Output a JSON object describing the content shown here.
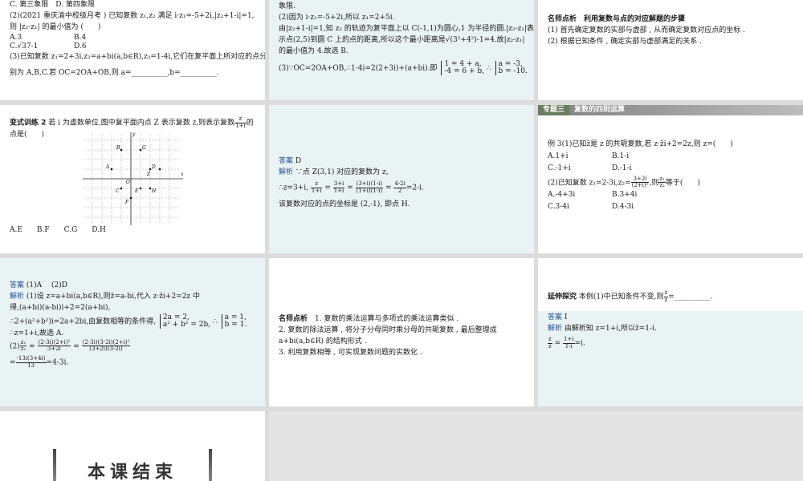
{
  "slide1": {
    "l1": "C. 第三象限　D. 第四象限",
    "l2": "(2)(2021 重庆渝中校级月考 ) 已知复数 z₁,z₂ 满足 i·z₁=-5+2i,|z₂+1-i|=1,",
    "l3": "则 |z₂-z₁| 的最小值为 (　　)",
    "opt_a": "A.3",
    "opt_b": "B.4",
    "opt_c": "C.√37-1",
    "opt_d": "D.6",
    "l4": "(3)已知复数 z₁=2+3i,z₂=a+bi(a,b∈R),z₃=1-4i,它们在复平面上所对应的点分",
    "l5": "别为 A,B,C.若 OC=2OA+OB,则 a=__________,b=__________."
  },
  "slide2": {
    "l1": "象限.",
    "l2": "(2)因为 i·z₁=-5+2i,所以 z₁=2+5i.",
    "l3": "由|z₂+1-i|=1,知 z₂ 的轨迹为复平面上以 C(-1,1)为圆心,1 为半径的圆.|z₂-z₁|表",
    "l4": "示点(2,5)到圆 C 上的点的距离,所以这个最小距离是√(3²+4²)-1=4.故|z₂-z₁|",
    "l5": "的最小值为 4.故选 B.",
    "l6": "(3)∵OC=2OA+OB,∴1-4i=2(2+3i)+(a+bi).即",
    "sys1": "1 = 4 + a,",
    "sys2": "-4 = 6 + b,",
    "therefore": "∴",
    "res1": "a = -3,",
    "res2": "b = -10."
  },
  "slide3": {
    "title": "名师点析　利用复数与点的对应解题的步骤",
    "l1": "(1) 首先确定复数的实部与虚部 , 从而确定复数对应点的坐标 .",
    "l2": "(2) 根据已知条件 , 确定实部与虚部满足的关系 ."
  },
  "slide4": {
    "title": "变式训练 2",
    "l1": " 若 i 为虚数单位,图中复平面内点 Z 表示复数 z,则表示复数",
    "frac_n": "z",
    "frac_d": "1+i",
    "l1_end": "的",
    "l2": "点是(　　)",
    "options": "A.E　　B.F　　C.G　　D.H",
    "axis_x": "x",
    "axis_y": "y",
    "origin": "O",
    "points": [
      "G",
      "B",
      "A",
      "D",
      "Z",
      "C",
      "E",
      "F",
      "H"
    ]
  },
  "slide5": {
    "answer_label": "答案",
    "answer": "D",
    "analysis_label": "解析",
    "l1": " ∵点 Z(3,1) 对应的复数为 z,",
    "l2_pre": "∴z=3+i,",
    "f1n": "z",
    "f1d": "1+i",
    "f2n": "3+i",
    "f2d": "1+i",
    "f3n": "(3+i)(1-i)",
    "f3d": "(1+i)(1-i)",
    "f4n": "4-2i",
    "f4d": "2",
    "l2_end": "=2-i.",
    "l3": "该复数对应的点的坐标是 (2,-1), 即点 H."
  },
  "slide6": {
    "tag": "专题三",
    "title": "复数的四则运算",
    "l1": "例 3(1)已知z̄是 z 的共轭复数,若 z·z̄i+2=2z,则 z=(　　)",
    "o1a": "A.1+i",
    "o1b": "B.1-i",
    "o1c": "C.-1+i",
    "o1d": "D.-1-i",
    "l2_pre": "(2)已知复数 z₁=2-3i,z₂=",
    "f1n": "3+2i",
    "f1d": "(2+i)²",
    "l2_mid": ",则",
    "f2n": "z₁",
    "f2d": "z₂",
    "l2_end": "等于(　　)",
    "o2a": "A.-4+3i",
    "o2b": "B.3+4i",
    "o2c": "C.3-4i",
    "o2d": "D.4-3i"
  },
  "slide7": {
    "answer_label": "答案",
    "answer": " (1)A　 (2)D",
    "analysis_label": "解析",
    "l1": " (1)设 z=a+bi(a,b∈R),则z̄=a-bi,代入 z·z̄i+2=2z 中",
    "l2": "得,(a+bi)(a-bi)i+2=2(a+bi),",
    "l3": "∴2+(a²+b²)i=2a+2bi,由复数相等的条件得,",
    "s1": "2a = 2,",
    "s2": "a² + b² = 2b,",
    "th": "∴",
    "r1": "a = 1,",
    "r2": "b = 1.",
    "l4": "∴z=1+i,故选 A.",
    "l5_pre": "(2)",
    "f1n": "z₁",
    "f1d": "z₂",
    "f2n": "(2-3i)(2+i)²",
    "f2d": "3+2i",
    "f3n": "(2-3i)(3-2i)(2+i)²",
    "f3d": "(3+2i)(3-2i)",
    "f4n": "-13i(3+4i)",
    "f4d": "13",
    "l6_end": "=4-3i."
  },
  "slide8": {
    "title": "名师点析",
    "l1": "　1. 复数的乘法运算与多项式的乘法运算类似 .",
    "l2": "2. 复数的除法运算 , 将分子分母同时乘分母的共轭复数 , 最后整理成",
    "l3": "a+bi(a,b∈R) 的结构形式 .",
    "l4": "3. 利用复数相等 , 可实现复数问题的实数化 ."
  },
  "slide9": {
    "title": "延伸探究",
    "l1_pre": " 本例(1)中已知条件不变,则",
    "fn": "z",
    "fd": "z̄",
    "l1_end": "=__________.",
    "answer_label": "答案",
    "answer": "I",
    "analysis_label": "解析",
    "l2": " 由解析知 z=1+i,所以z̄=1-i.",
    "f2n": "z",
    "f2d": "z̄",
    "f3n": "1+i",
    "f3d": "1-i",
    "l3_end": "=i."
  },
  "slide10": {
    "end_text": "本课结束"
  }
}
